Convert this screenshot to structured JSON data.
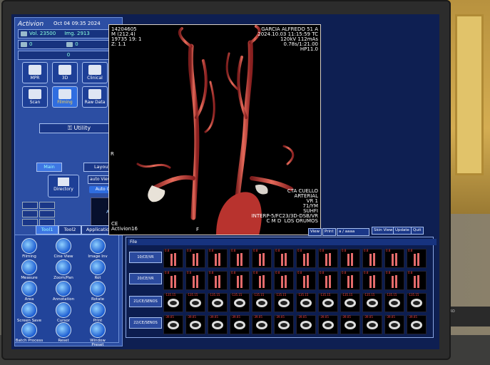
{
  "app": {
    "logo": "Activion",
    "datetime": "Oct 04 09:35 2024"
  },
  "left_panel": {
    "volume_label": "Vol. 23500",
    "image_label": "Img. 2913",
    "counter1_a": "0",
    "counter1_b": "0",
    "counter2": "0",
    "tiles": [
      {
        "label": "MPR",
        "icon": "mpr-icon"
      },
      {
        "label": "3D",
        "icon": "3d-icon"
      },
      {
        "label": "Clinical",
        "icon": "clinical-icon"
      },
      {
        "label": "Scan",
        "icon": "scan-icon"
      },
      {
        "label": "Filming",
        "icon": "filming-icon"
      },
      {
        "label": "Raw Data",
        "icon": "raw-data-icon"
      }
    ],
    "utility_label": "Utility",
    "main_tab": "Main",
    "layout_tab": "Layout",
    "directory_label": "Directory",
    "combo_value": "auto View Sel",
    "auto_case": "Auto Case",
    "preview_text": "A"
  },
  "tool_tabs": [
    "Tool1",
    "Tool2",
    "Application"
  ],
  "tools": [
    "Filming",
    "Cine View",
    "Image Inv",
    "Measure",
    "Zoom/Pan",
    "Rot",
    "Area",
    "Annotation",
    "Rotate",
    "Screen Save",
    "Cursor",
    "Print",
    "Batch Process",
    "Reset",
    "Window Preset"
  ],
  "viewer": {
    "tl": "14204605\nM (212.4)\n19735 19: 1\nZ: 1.1",
    "tr": "GARCIA ALFREDO 51 A\n2024.10.03 11:15:59 TC\n120kV 112mAs\n0.78s/1:21.00\nHP11.0",
    "br": "CTA CUELLO\nARTERIAL\nVR 1\n71/YM\nSUHFI\nINTERP-5/FC23/3D-DSB/VR\nC M D  LOS ORUMOS",
    "bl": "CE\nActivion16",
    "left_marker": "R",
    "bottom_marker": "F"
  },
  "top_buttons": [
    "View",
    "Print",
    "a / aaaa",
    "Skin View",
    "Update",
    "Quit"
  ],
  "browser": {
    "header": "File",
    "series": [
      "10/CE/VR",
      "20/CE/VR",
      "21/CE/SENOS",
      "22/CE/SENOS"
    ],
    "row_captions": [
      "0.8",
      "0.8",
      "-135.15",
      "-39.05"
    ]
  }
}
